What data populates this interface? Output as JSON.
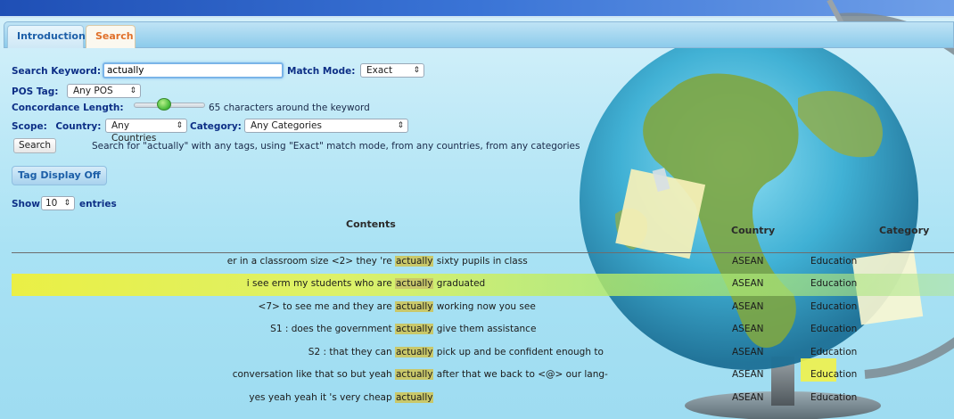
{
  "tabs": [
    "Introduction",
    "Search"
  ],
  "search": {
    "keyword_label": "Search Keyword:",
    "keyword_value": "actually",
    "match_label": "Match Mode:",
    "match_value": "Exact",
    "pos_label": "POS Tag:",
    "pos_value": "Any POS",
    "concordance_label": "Concordance Length:",
    "concordance_level": 65,
    "concordance_text": "65 characters around the keyword",
    "scope_label": "Scope:",
    "country_label": "Country:",
    "country_value": "Any Countries",
    "category_label": "Category:",
    "category_value": "Any Categories",
    "button_label": "Search",
    "summary": "Search for \"actually\" with any tags, using \"Exact\" match mode, from any countries, from any categories"
  },
  "tag_display_button": "Tag Display Off",
  "entries": {
    "show_label": "Show",
    "value": "10",
    "entries_label": "entries"
  },
  "table": {
    "headers": {
      "contents": "Contents",
      "country": "Country",
      "category": "Category"
    },
    "rows": [
      {
        "left": "er in a classroom size <2> they 're ",
        "kw": "actually",
        "right": " sixty pupils in class",
        "country": "ASEAN",
        "category": "Education"
      },
      {
        "left": "i see erm my students who are ",
        "kw": "actually",
        "right": " graduated",
        "country": "ASEAN",
        "category": "Education"
      },
      {
        "left": "<7> to see me and they are ",
        "kw": "actually",
        "right": " working now you see",
        "country": "ASEAN",
        "category": "Education"
      },
      {
        "left": "S1 : does the government ",
        "kw": "actually",
        "right": " give them assistance",
        "country": "ASEAN",
        "category": "Education"
      },
      {
        "left": "S2 : that they can ",
        "kw": "actually",
        "right": " pick up and be confident enough to",
        "country": "ASEAN",
        "category": "Education"
      },
      {
        "left": "conversation like that so but yeah ",
        "kw": "actually",
        "right": " after that we back to <@> our lang-",
        "country": "ASEAN",
        "category": "Education"
      },
      {
        "left": "yes yeah yeah it 's very cheap ",
        "kw": "actually",
        "right": "",
        "country": "ASEAN",
        "category": "Education"
      }
    ]
  }
}
